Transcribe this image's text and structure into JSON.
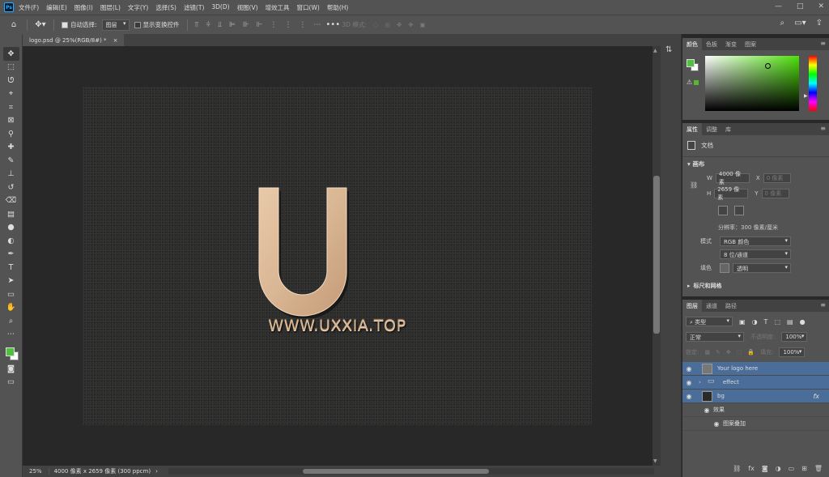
{
  "app": {
    "logo_text": "Ps"
  },
  "menu": [
    "文件(F)",
    "编辑(E)",
    "图像(I)",
    "图层(L)",
    "文字(Y)",
    "选择(S)",
    "滤镜(T)",
    "3D(D)",
    "视图(V)",
    "增效工具",
    "窗口(W)",
    "帮助(H)"
  ],
  "window_controls": {
    "minimize": "—",
    "maximize": "□",
    "close": "✕"
  },
  "options_bar": {
    "auto_select_label": "自动选择:",
    "auto_select_value": "图层",
    "show_transform_label": "显示变换控件",
    "mode_3d_label": "3D 模式:",
    "more": "•••"
  },
  "document": {
    "tab_title": "logo.psd @ 25%(RGB/8#) *",
    "tab_close": "×",
    "logo_text": "WWW.UXXIA.TOP"
  },
  "status_bar": {
    "zoom": "25%",
    "info": "4000 像素 x 2659 像素 (300 ppcm)",
    "arrow": "›"
  },
  "color_panel": {
    "tabs": [
      "颜色",
      "色板",
      "渐变",
      "图案"
    ],
    "foreground": "#4fc13e",
    "background": "#ffffff",
    "hue_color": "#4ee10a"
  },
  "properties_panel": {
    "tabs": [
      "属性",
      "调整",
      "库"
    ],
    "doc_label": "文档",
    "canvas_header": "画布",
    "w_label": "W",
    "w_value": "4000 像素",
    "x_label": "X",
    "x_value": "0 像素",
    "h_label": "H",
    "h_value": "2659 像素",
    "y_label": "Y",
    "y_value": "0 像素",
    "resolution": "分辨率：300 像素/厘米",
    "mode_label": "模式",
    "mode_value": "RGB 颜色",
    "depth_value": "8 位/通道",
    "fill_label": "填色",
    "fill_value": "透明",
    "next_section": "标尺和网格"
  },
  "layers_panel": {
    "tabs": [
      "图层",
      "通道",
      "路径"
    ],
    "filter_type": "类型",
    "blend_mode": "正常",
    "opacity_label": "不透明度:",
    "opacity_value": "100%",
    "lock_label": "锁定:",
    "fill_label": "填充:",
    "fill_value": "100%",
    "layers": [
      {
        "name": "Your logo here",
        "kind": "smart"
      },
      {
        "name": "effect",
        "kind": "group"
      },
      {
        "name": "bg",
        "kind": "fill",
        "fx": "fx"
      }
    ],
    "effects_label": "效果",
    "effect_item": "图案叠加"
  }
}
